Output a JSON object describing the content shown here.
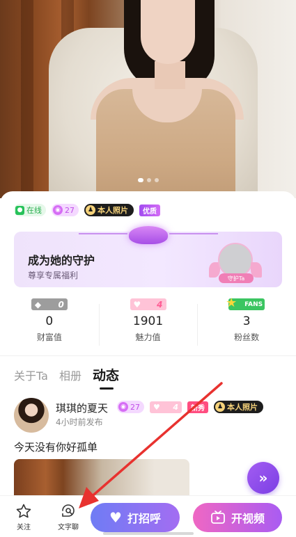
{
  "badges": {
    "online": "在线",
    "level": "27",
    "real_photo": "本人照片",
    "quality": "优质"
  },
  "guardian": {
    "title": "成为她的守护",
    "subtitle": "尊享专属福利",
    "ribbon": "守护Ta"
  },
  "stats": [
    {
      "pill_value": "0",
      "number": "0",
      "label": "财富值"
    },
    {
      "pill_value": "4",
      "number": "1901",
      "label": "魅力值"
    },
    {
      "pill_value": "FANS",
      "number": "3",
      "label": "粉丝数"
    }
  ],
  "tabs": [
    "关于Ta",
    "相册",
    "动态"
  ],
  "active_tab": "动态",
  "post": {
    "name": "琪琪的夏天",
    "level": "27",
    "charm": "4",
    "new_badge": "新秀",
    "real_photo": "本人照片",
    "time": "4小时前发布",
    "content": "今天没有你好孤单"
  },
  "fab_label": "»",
  "bottom_nav": {
    "follow": "关注",
    "text_chat": "文字聊",
    "greet": "打招呼",
    "video": "开视频"
  },
  "colors": {
    "accent_purple": "#a36df2",
    "annotation_red": "#e8322f"
  }
}
